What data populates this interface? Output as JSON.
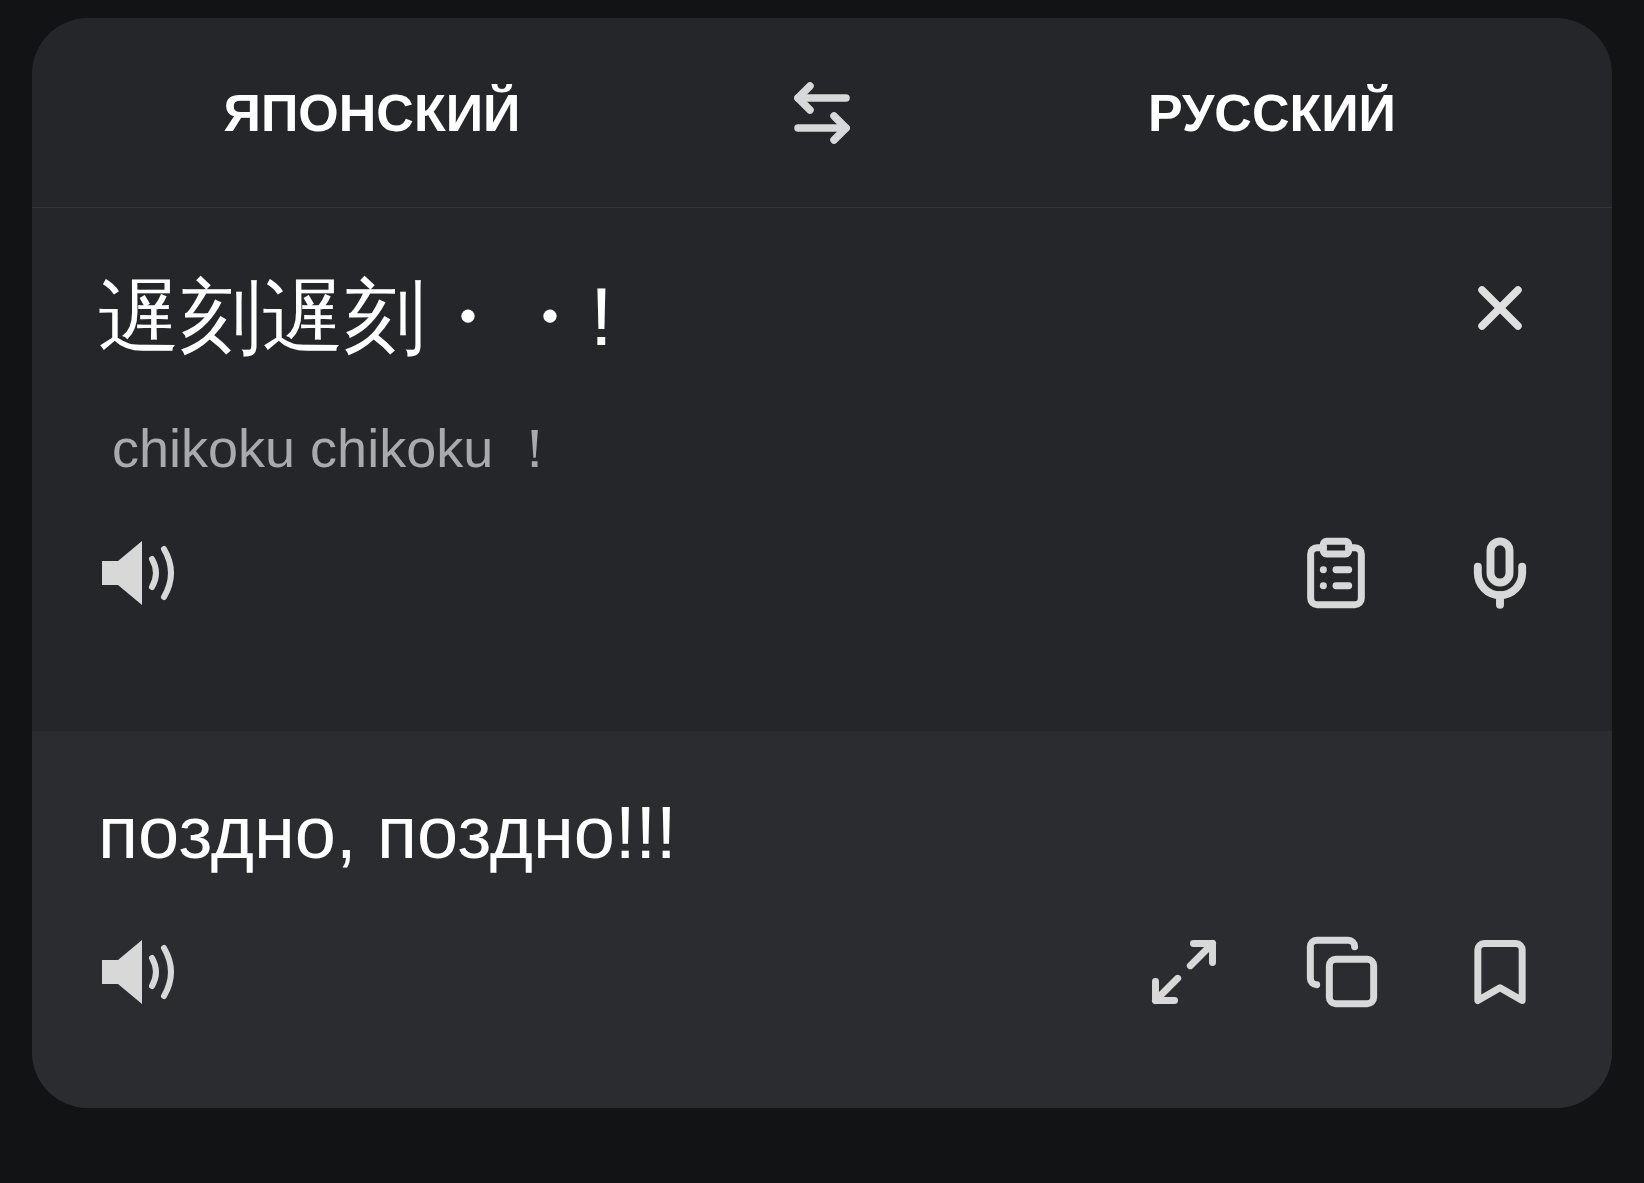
{
  "languages": {
    "source": "ЯПОНСКИЙ",
    "target": "РУССКИЙ"
  },
  "source": {
    "text": "遅刻遅刻・・!",
    "transliteration": "chikoku chikoku ！"
  },
  "translation": {
    "text": "поздно, поздно!!!"
  }
}
